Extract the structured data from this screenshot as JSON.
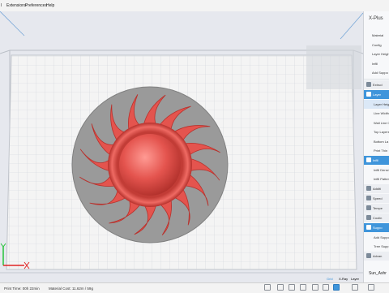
{
  "menu": {
    "partial_item": "l",
    "items": [
      "Extensions",
      "Preferences",
      "Help"
    ]
  },
  "right_panel": {
    "title": "X-Plus",
    "rows": [
      {
        "label": "Material",
        "kind": "plain"
      },
      {
        "label": "Config",
        "kind": "plain"
      },
      {
        "label": "Layer Heigh",
        "kind": "plain"
      },
      {
        "label": "Infill",
        "kind": "plain"
      },
      {
        "label": "Add Suppo",
        "kind": "plain"
      },
      {
        "label": "Extrud",
        "kind": "header",
        "icon": "extruder-icon"
      },
      {
        "label": "Layer",
        "kind": "header-active",
        "icon": "layer-icon"
      },
      {
        "label": "Layer Heig",
        "kind": "sub-selected"
      },
      {
        "label": "Line Width",
        "kind": "sub"
      },
      {
        "label": "Wall Line C",
        "kind": "sub"
      },
      {
        "label": "Top Layers",
        "kind": "sub"
      },
      {
        "label": "Bottom La",
        "kind": "sub"
      },
      {
        "label": "Print Thin",
        "kind": "sub"
      },
      {
        "label": "Infill",
        "kind": "header-active",
        "icon": "infill-icon"
      },
      {
        "label": "Infill Densi",
        "kind": "sub"
      },
      {
        "label": "Infill Patter",
        "kind": "sub"
      },
      {
        "label": "Additi",
        "kind": "header",
        "icon": "additions-icon"
      },
      {
        "label": "Speed",
        "kind": "header",
        "icon": "speed-icon"
      },
      {
        "label": "Tempe",
        "kind": "header",
        "icon": "temperature-icon"
      },
      {
        "label": "Coolin",
        "kind": "header",
        "icon": "cooling-icon"
      },
      {
        "label": "Suppo",
        "kind": "header-active",
        "icon": "support-icon"
      },
      {
        "label": "Add Suppo",
        "kind": "sub"
      },
      {
        "label": "Tree Supp",
        "kind": "sub"
      },
      {
        "label": "Advan",
        "kind": "header",
        "icon": "advanced-icon"
      }
    ],
    "footer": "Sun_Ashr"
  },
  "view_controls": {
    "active": "Grid",
    "items": [
      "Grid",
      "X-Ray",
      "Layer"
    ]
  },
  "status": {
    "print_time": "Print Time: 00h 22min",
    "material_cost": "Material Cost: 11.62m / 59g"
  },
  "toolbar_icons": [
    {
      "name": "move-icon",
      "active": false
    },
    {
      "name": "scale-icon",
      "active": false
    },
    {
      "name": "rotate-icon",
      "active": false
    },
    {
      "name": "mirror-icon",
      "active": false
    },
    {
      "name": "copy-icon",
      "active": false
    },
    {
      "name": "settings-icon",
      "active": false
    },
    {
      "name": "slice-view-icon",
      "active": true
    },
    {
      "name": "export-icon",
      "active": false
    },
    {
      "name": "print-icon",
      "active": false
    }
  ],
  "colors": {
    "model": "#e4544e",
    "model_shade": "#b8312c",
    "plate_base": "#9a9a9a",
    "build_plate": "#f4f4f4",
    "grid": "#cfd3da",
    "accent": "#3f95db"
  }
}
